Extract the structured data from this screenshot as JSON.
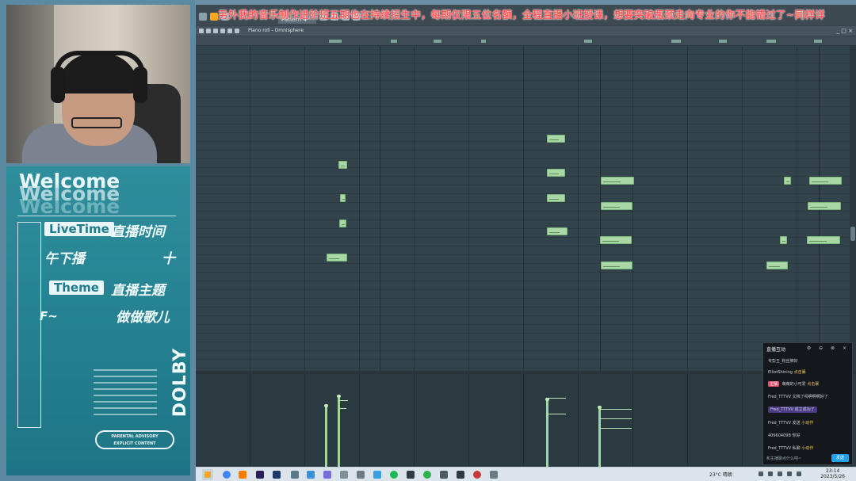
{
  "ticker": "另外我的音乐制作进阶班五期也在持续招生中，每期仅限五位名额，全程直播小班授课，想要突破瓶颈走向专业的你不能错过了~同样详",
  "toolbar": {
    "pattern_label": "Pattern 4"
  },
  "piano_roll": {
    "title": "Piano roll - Omnisphere",
    "window_controls": "_ □ ×"
  },
  "poster": {
    "welcome": [
      "Welcome",
      "Welcome",
      "Welcome"
    ],
    "livetime_pill": "LiveTime",
    "livetime_text": "直播时间",
    "schedule_text": "午下播",
    "plus": "十",
    "theme_pill": "Theme",
    "theme_text": "直播主题",
    "tilde": "F~",
    "topic_text": "做做歌儿",
    "dolby": "DOLBY",
    "advisory_line1": "PARENTAL ADVISORY",
    "advisory_line2": "EXPLICIT CONTENT"
  },
  "chat": {
    "title": "直播互动",
    "controls": "⚙ ⊖ ⊗ ×",
    "messages": [
      {
        "name": "",
        "text": "专彭王_粉丝牌好"
      },
      {
        "name": "ElliotShining",
        "text": "",
        "gold": "点击暴"
      },
      {
        "tag": "主播",
        "name": "",
        "text": "萌萌的小可爱",
        "gold": "点击暴"
      },
      {
        "name": "Fred_TTTVV",
        "text": "文档了吗啊啊啊好了"
      },
      {
        "name": "Fred_TTTVV",
        "text": "成立成功了",
        "hl": true
      },
      {
        "name": "Fred_TTTVV",
        "text": "发送",
        "gold": "小动作"
      },
      {
        "name": "40960409B",
        "text": "你好"
      },
      {
        "name": "Fred_TTTVV",
        "text": "私聊",
        "gold": "小动作"
      }
    ],
    "input_placeholder": "和主播聊点什么吧~",
    "send_label": "发送"
  },
  "taskbar": {
    "weather": "23°C 晴朗",
    "time": "23:14",
    "date": "2023/5/26"
  }
}
